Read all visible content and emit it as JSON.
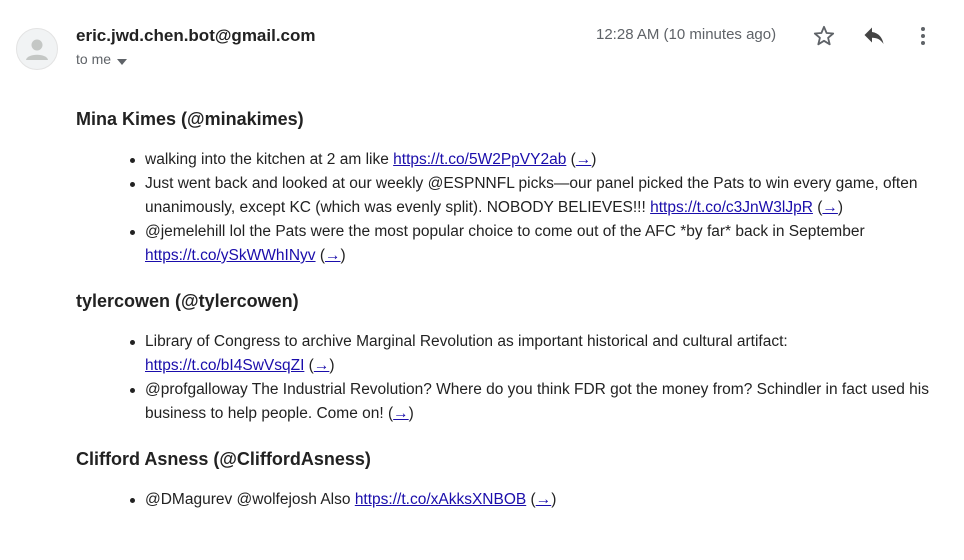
{
  "header": {
    "sender": "eric.jwd.chen.bot@gmail.com",
    "to": "to me",
    "timestamp": "12:28 AM (10 minutes ago)"
  },
  "sections": [
    {
      "title": "Mina Kimes (@minakimes)",
      "items": [
        {
          "text": "walking into the kitchen at 2 am like ",
          "link": "https://t.co/5W2PpVY2ab",
          "arrow": "→"
        },
        {
          "text": "Just went back and looked at our weekly @ESPNNFL picks—our panel picked the Pats to win every game, often unanimously, except KC (which was evenly split). NOBODY BELIEVES!!! ",
          "link": "https://t.co/c3JnW3lJpR",
          "arrow": "→"
        },
        {
          "text": "@jemelehill lol the Pats were the most popular choice to come out of the AFC *by far* back in September ",
          "link": "https://t.co/ySkWWhINyv",
          "arrow": "→"
        }
      ]
    },
    {
      "title": "tylercowen (@tylercowen)",
      "items": [
        {
          "text": "Library of Congress to archive Marginal Revolution as important historical and cultural artifact: ",
          "link": "https://t.co/bI4SwVsqZI",
          "arrow": "→"
        },
        {
          "text": "@profgalloway The Industrial Revolution? Where do you think FDR got the money from? Schindler in fact used his business to help people. Come on! ",
          "link": "",
          "arrow": "→"
        }
      ]
    },
    {
      "title": "Clifford Asness (@CliffordAsness)",
      "items": [
        {
          "text": "@DMagurev @wolfejosh Also ",
          "link": "https://t.co/xAkksXNBOB",
          "arrow": "→"
        }
      ]
    }
  ],
  "icons": {
    "avatar": "person-icon",
    "star": "star-icon",
    "reply": "reply-icon",
    "more": "more-vert-icon",
    "caret": "caret-down-icon"
  }
}
